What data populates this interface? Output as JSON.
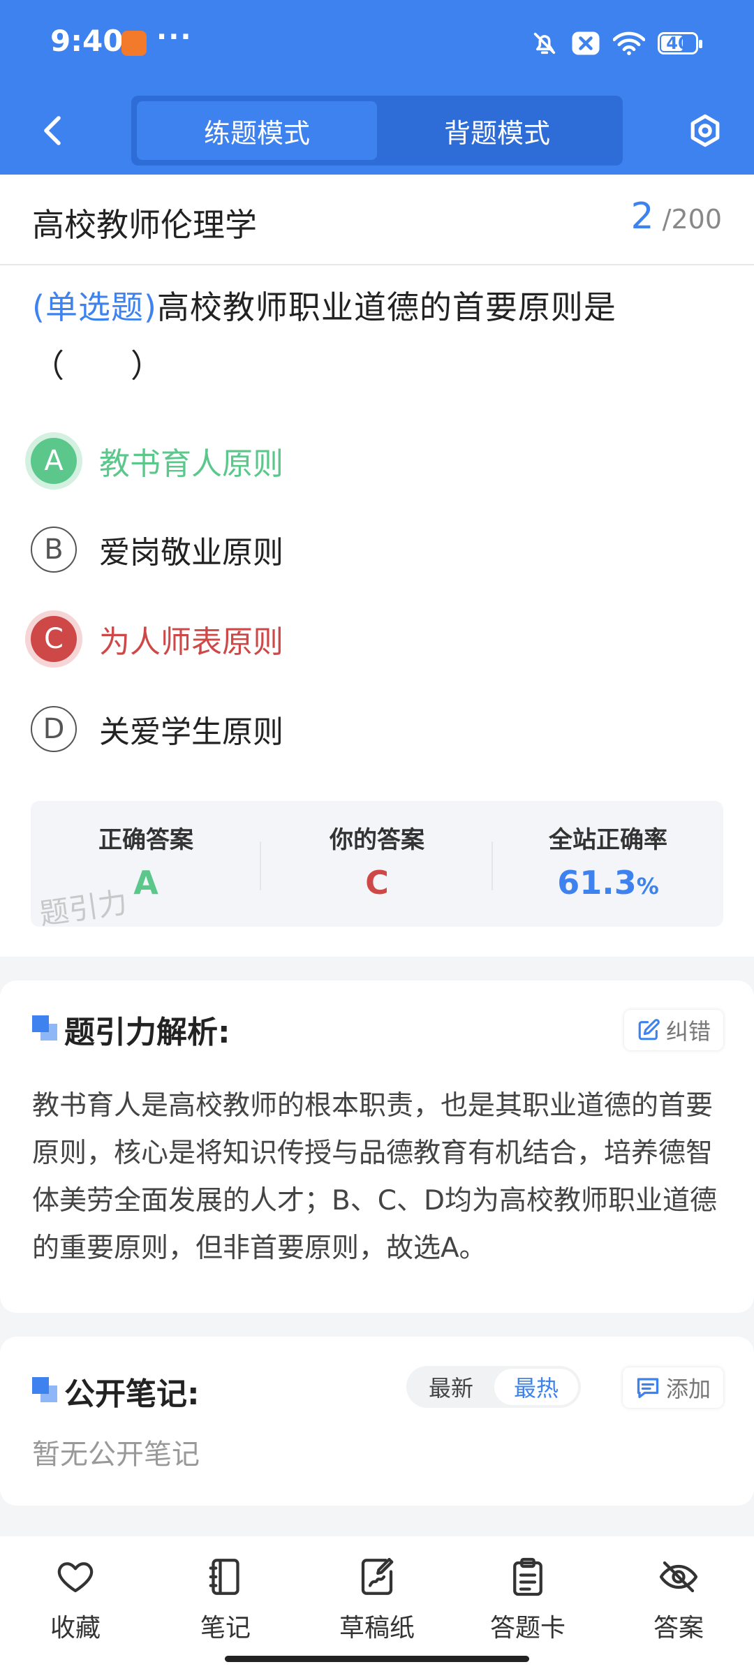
{
  "status_bar": {
    "time": "9:40",
    "dots": "···",
    "battery": "40"
  },
  "nav": {
    "tabs": [
      {
        "label": "练题模式",
        "active": true
      },
      {
        "label": "背题模式",
        "active": false
      }
    ]
  },
  "subject": {
    "title": "高校教师伦理学",
    "current": "2",
    "total": "200",
    "separator": "/"
  },
  "question": {
    "type_label": "(单选题)",
    "text": "高校教师职业道德的首要原则是（　　）"
  },
  "options": [
    {
      "letter": "A",
      "text": "教书育人原则",
      "state": "correct"
    },
    {
      "letter": "B",
      "text": "爱岗敬业原则",
      "state": "normal"
    },
    {
      "letter": "C",
      "text": "为人师表原则",
      "state": "wrong"
    },
    {
      "letter": "D",
      "text": "关爱学生原则",
      "state": "normal"
    }
  ],
  "stats": {
    "correct_label": "正确答案",
    "correct_value": "A",
    "yours_label": "你的答案",
    "yours_value": "C",
    "rate_label": "全站正确率",
    "rate_value": "61.3",
    "rate_unit": "%",
    "watermark": "题引力"
  },
  "analysis": {
    "title": "题引力解析:",
    "report_label": "纠错",
    "text": "教书育人是高校教师的根本职责，也是其职业道德的首要原则，核心是将知识传授与品德教育有机结合，培养德智体美劳全面发展的人才；B、C、D均为高校教师职业道德的重要原则，但非首要原则，故选A。"
  },
  "notes": {
    "title": "公开笔记:",
    "sort_latest": "最新",
    "sort_hot": "最热",
    "add_label": "添加",
    "empty_text": "暂无公开笔记"
  },
  "bottom_tabs": [
    {
      "label": "收藏",
      "icon": "heart-icon"
    },
    {
      "label": "笔记",
      "icon": "notebook-icon"
    },
    {
      "label": "草稿纸",
      "icon": "draft-paper-icon"
    },
    {
      "label": "答题卡",
      "icon": "answer-sheet-icon"
    },
    {
      "label": "答案",
      "icon": "eye-off-icon"
    }
  ],
  "colors": {
    "brand": "#3d82ee",
    "correct": "#5bc78b",
    "wrong": "#cd4847"
  }
}
